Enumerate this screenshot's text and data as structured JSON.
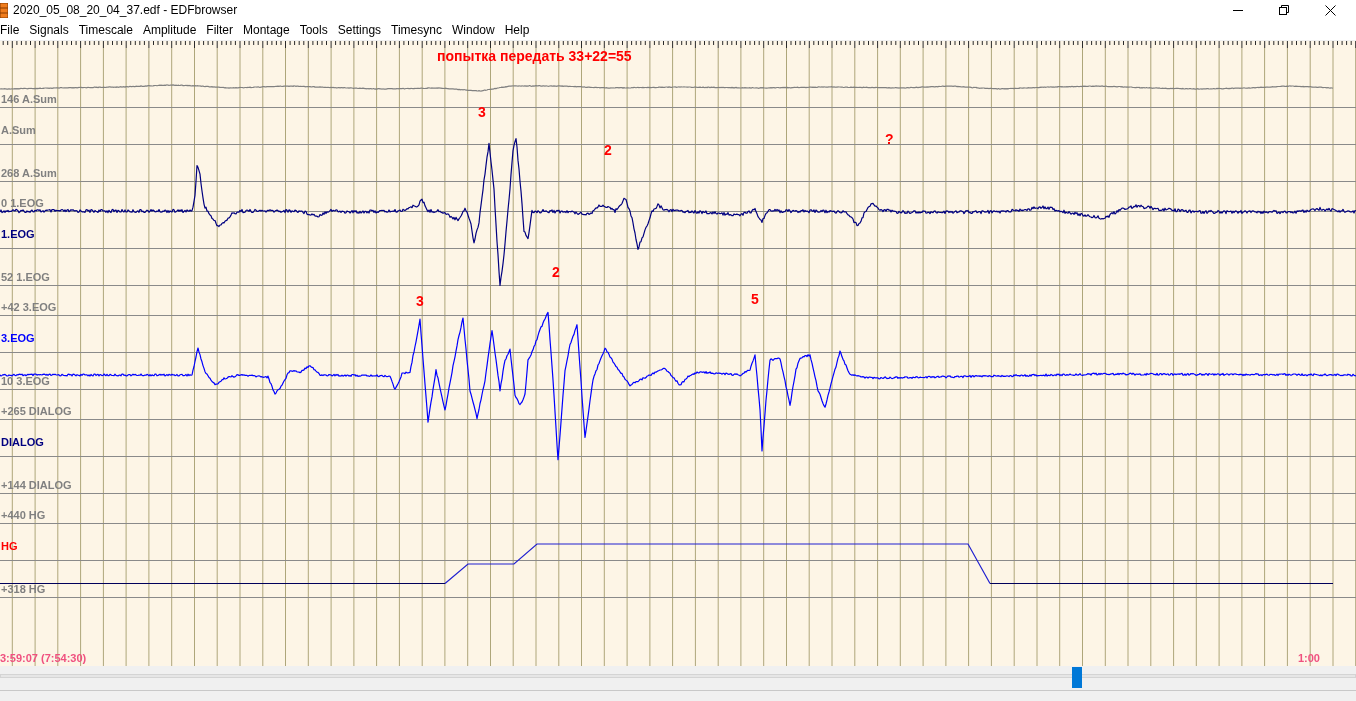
{
  "window": {
    "title": "2020_05_08_20_04_37.edf - EDFbrowser"
  },
  "menu": [
    "File",
    "Signals",
    "Timescale",
    "Amplitude",
    "Filter",
    "Montage",
    "Tools",
    "Settings",
    "Timesync",
    "Window",
    "Help"
  ],
  "channels": [
    {
      "name": "A.Sum",
      "color": "#808080",
      "upper_reading": "146 A.Sum",
      "lower_reading": "268 A.Sum"
    },
    {
      "name": "1.EOG",
      "color": "#000080",
      "upper_reading": "0 1.EOG",
      "lower_reading": "52 1.EOG"
    },
    {
      "name": "3.EOG",
      "color": "#0000ff",
      "upper_reading": "+42 3.EOG",
      "lower_reading": "10 3.EOG"
    },
    {
      "name": "DIALOG",
      "color": "#000080",
      "upper_reading": "+265 DIALOG",
      "lower_reading": "+144 DIALOG"
    },
    {
      "name": "HG",
      "color": "#ff0000",
      "upper_reading": "+440 HG",
      "lower_reading": "+318 HG"
    }
  ],
  "annotations": [
    {
      "text": "попытка передать 33+22=55"
    },
    {
      "text": "3"
    },
    {
      "text": "2"
    },
    {
      "text": "?"
    },
    {
      "text": "2"
    },
    {
      "text": "3"
    },
    {
      "text": "5"
    }
  ],
  "timeline": {
    "position": "3:59:07 (7:54:30)",
    "page_length": "1:00"
  }
}
